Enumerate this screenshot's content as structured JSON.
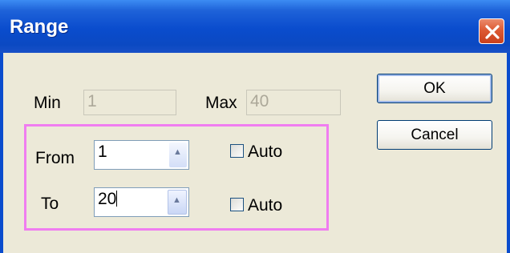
{
  "window": {
    "title": "Range"
  },
  "range": {
    "min_label": "Min",
    "min_value": "1",
    "max_label": "Max",
    "max_value": "40"
  },
  "from": {
    "label": "From",
    "value": "1",
    "auto_label": "Auto",
    "auto_checked": false
  },
  "to": {
    "label": "To",
    "value": "20",
    "auto_label": "Auto",
    "auto_checked": false
  },
  "buttons": {
    "ok": "OK",
    "cancel": "Cancel"
  },
  "colors": {
    "title_bar": "#0a4ccd",
    "dialog_bg": "#ece9d8",
    "highlight": "#f07df0",
    "close": "#dd5a34"
  },
  "icons": {
    "close": "close-icon",
    "spin_up": "spin-up-icon"
  }
}
